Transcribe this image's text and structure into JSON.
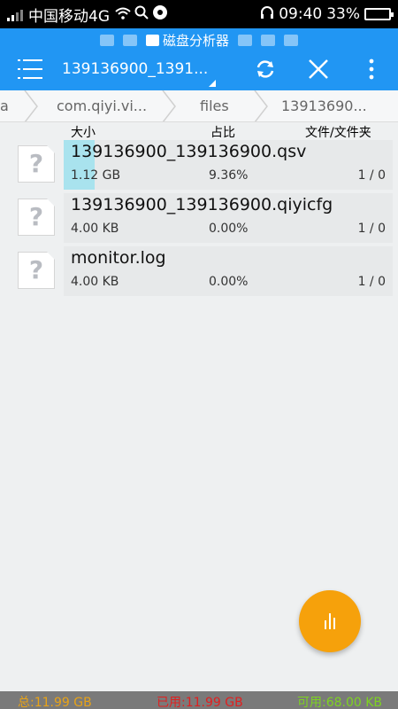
{
  "status_bar": {
    "carrier": "中国移动4G",
    "time": "09:40",
    "battery_percent": "33%",
    "battery_level": 0.33
  },
  "app": {
    "title": "磁盘分析器",
    "current_path": "139136900_1391...",
    "accent_color": "#2196f3"
  },
  "breadcrumb": [
    "a",
    "com.qiyi.vi...",
    "files",
    "13913690..."
  ],
  "columns": {
    "size": "大小",
    "share": "占比",
    "files": "文件/文件夹"
  },
  "files": [
    {
      "name": "139136900_139136900.qsv",
      "size": "1.12 GB",
      "percent": "9.36%",
      "percent_value": 9.36,
      "count": "1 / 0",
      "icon": "unknown-file-icon"
    },
    {
      "name": "139136900_139136900.qiyicfg",
      "size": "4.00 KB",
      "percent": "0.00%",
      "percent_value": 0.0,
      "count": "1 / 0",
      "icon": "unknown-file-icon"
    },
    {
      "name": "monitor.log",
      "size": "4.00 KB",
      "percent": "0.00%",
      "percent_value": 0.0,
      "count": "1 / 0",
      "icon": "unknown-file-icon"
    }
  ],
  "footer": {
    "total": "总:11.99 GB",
    "used": "已用:11.99 GB",
    "free": "可用:68.00 KB",
    "total_color": "#e8a317",
    "used_color": "#e02020",
    "free_color": "#7ed321"
  }
}
